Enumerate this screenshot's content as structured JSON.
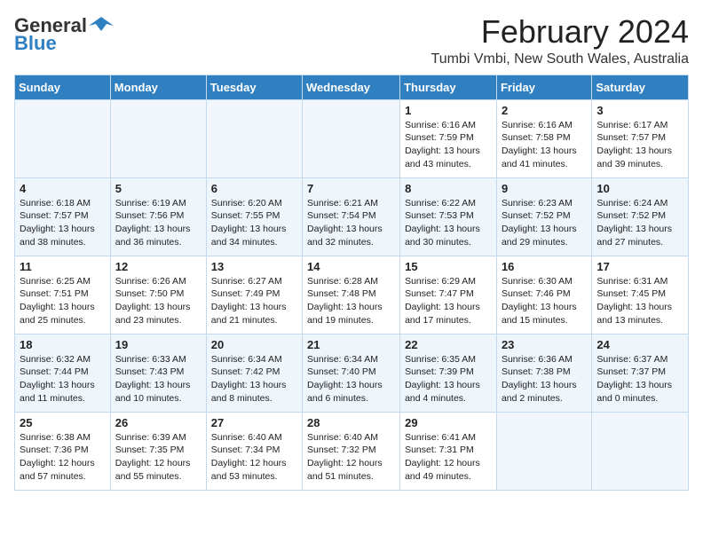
{
  "header": {
    "logo_general": "General",
    "logo_blue": "Blue",
    "title": "February 2024",
    "subtitle": "Tumbi Vmbi, New South Wales, Australia"
  },
  "days_of_week": [
    "Sunday",
    "Monday",
    "Tuesday",
    "Wednesday",
    "Thursday",
    "Friday",
    "Saturday"
  ],
  "weeks": [
    [
      {
        "day": "",
        "info": ""
      },
      {
        "day": "",
        "info": ""
      },
      {
        "day": "",
        "info": ""
      },
      {
        "day": "",
        "info": ""
      },
      {
        "day": "1",
        "info": "Sunrise: 6:16 AM\nSunset: 7:59 PM\nDaylight: 13 hours and 43 minutes."
      },
      {
        "day": "2",
        "info": "Sunrise: 6:16 AM\nSunset: 7:58 PM\nDaylight: 13 hours and 41 minutes."
      },
      {
        "day": "3",
        "info": "Sunrise: 6:17 AM\nSunset: 7:57 PM\nDaylight: 13 hours and 39 minutes."
      }
    ],
    [
      {
        "day": "4",
        "info": "Sunrise: 6:18 AM\nSunset: 7:57 PM\nDaylight: 13 hours and 38 minutes."
      },
      {
        "day": "5",
        "info": "Sunrise: 6:19 AM\nSunset: 7:56 PM\nDaylight: 13 hours and 36 minutes."
      },
      {
        "day": "6",
        "info": "Sunrise: 6:20 AM\nSunset: 7:55 PM\nDaylight: 13 hours and 34 minutes."
      },
      {
        "day": "7",
        "info": "Sunrise: 6:21 AM\nSunset: 7:54 PM\nDaylight: 13 hours and 32 minutes."
      },
      {
        "day": "8",
        "info": "Sunrise: 6:22 AM\nSunset: 7:53 PM\nDaylight: 13 hours and 30 minutes."
      },
      {
        "day": "9",
        "info": "Sunrise: 6:23 AM\nSunset: 7:52 PM\nDaylight: 13 hours and 29 minutes."
      },
      {
        "day": "10",
        "info": "Sunrise: 6:24 AM\nSunset: 7:52 PM\nDaylight: 13 hours and 27 minutes."
      }
    ],
    [
      {
        "day": "11",
        "info": "Sunrise: 6:25 AM\nSunset: 7:51 PM\nDaylight: 13 hours and 25 minutes."
      },
      {
        "day": "12",
        "info": "Sunrise: 6:26 AM\nSunset: 7:50 PM\nDaylight: 13 hours and 23 minutes."
      },
      {
        "day": "13",
        "info": "Sunrise: 6:27 AM\nSunset: 7:49 PM\nDaylight: 13 hours and 21 minutes."
      },
      {
        "day": "14",
        "info": "Sunrise: 6:28 AM\nSunset: 7:48 PM\nDaylight: 13 hours and 19 minutes."
      },
      {
        "day": "15",
        "info": "Sunrise: 6:29 AM\nSunset: 7:47 PM\nDaylight: 13 hours and 17 minutes."
      },
      {
        "day": "16",
        "info": "Sunrise: 6:30 AM\nSunset: 7:46 PM\nDaylight: 13 hours and 15 minutes."
      },
      {
        "day": "17",
        "info": "Sunrise: 6:31 AM\nSunset: 7:45 PM\nDaylight: 13 hours and 13 minutes."
      }
    ],
    [
      {
        "day": "18",
        "info": "Sunrise: 6:32 AM\nSunset: 7:44 PM\nDaylight: 13 hours and 11 minutes."
      },
      {
        "day": "19",
        "info": "Sunrise: 6:33 AM\nSunset: 7:43 PM\nDaylight: 13 hours and 10 minutes."
      },
      {
        "day": "20",
        "info": "Sunrise: 6:34 AM\nSunset: 7:42 PM\nDaylight: 13 hours and 8 minutes."
      },
      {
        "day": "21",
        "info": "Sunrise: 6:34 AM\nSunset: 7:40 PM\nDaylight: 13 hours and 6 minutes."
      },
      {
        "day": "22",
        "info": "Sunrise: 6:35 AM\nSunset: 7:39 PM\nDaylight: 13 hours and 4 minutes."
      },
      {
        "day": "23",
        "info": "Sunrise: 6:36 AM\nSunset: 7:38 PM\nDaylight: 13 hours and 2 minutes."
      },
      {
        "day": "24",
        "info": "Sunrise: 6:37 AM\nSunset: 7:37 PM\nDaylight: 13 hours and 0 minutes."
      }
    ],
    [
      {
        "day": "25",
        "info": "Sunrise: 6:38 AM\nSunset: 7:36 PM\nDaylight: 12 hours and 57 minutes."
      },
      {
        "day": "26",
        "info": "Sunrise: 6:39 AM\nSunset: 7:35 PM\nDaylight: 12 hours and 55 minutes."
      },
      {
        "day": "27",
        "info": "Sunrise: 6:40 AM\nSunset: 7:34 PM\nDaylight: 12 hours and 53 minutes."
      },
      {
        "day": "28",
        "info": "Sunrise: 6:40 AM\nSunset: 7:32 PM\nDaylight: 12 hours and 51 minutes."
      },
      {
        "day": "29",
        "info": "Sunrise: 6:41 AM\nSunset: 7:31 PM\nDaylight: 12 hours and 49 minutes."
      },
      {
        "day": "",
        "info": ""
      },
      {
        "day": "",
        "info": ""
      }
    ]
  ]
}
